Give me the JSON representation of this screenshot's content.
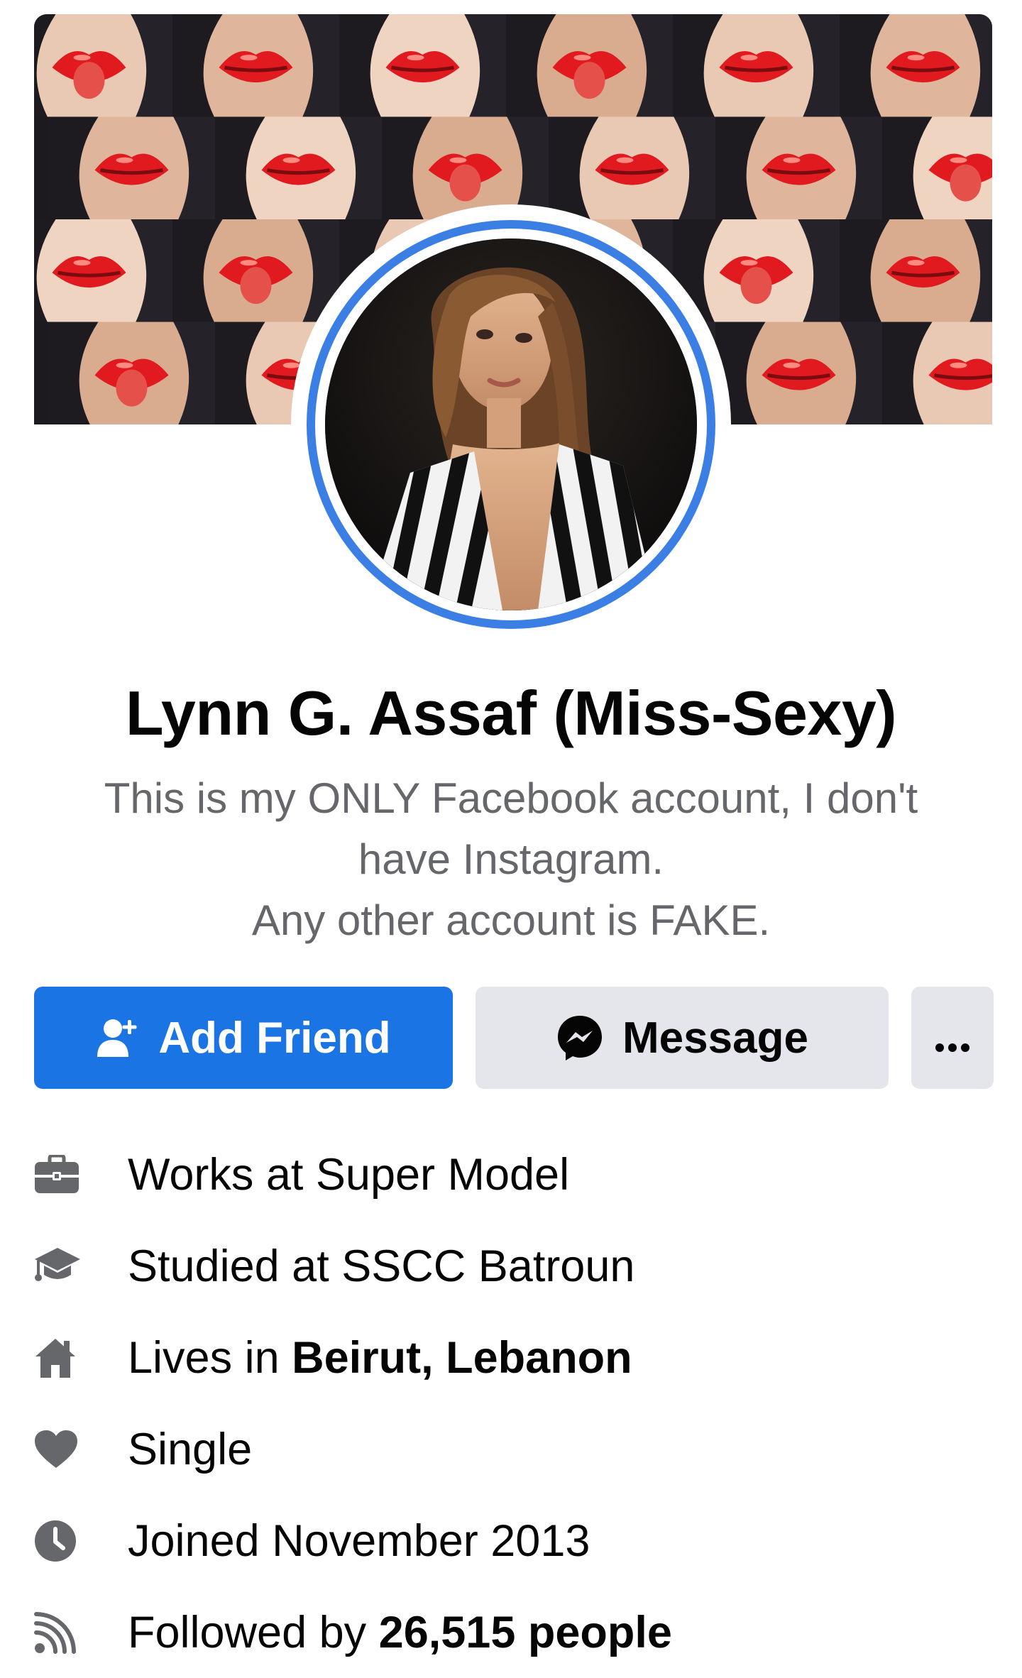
{
  "profile": {
    "name": "Lynn G. Assaf (Miss-Sexy)",
    "bio_lines": [
      "This is my ONLY Facebook account, I don't",
      "have Instagram.",
      "Any other account is FAKE."
    ]
  },
  "actions": {
    "add_friend_label": "Add Friend",
    "message_label": "Message",
    "more_icon": "more-dots-icon"
  },
  "details": [
    {
      "icon": "briefcase-icon",
      "prefix": "Works at Super Model",
      "bold": ""
    },
    {
      "icon": "graduation-cap-icon",
      "prefix": "Studied at SSCC Batroun",
      "bold": ""
    },
    {
      "icon": "home-icon",
      "prefix": "Lives in ",
      "bold": "Beirut, Lebanon"
    },
    {
      "icon": "heart-icon",
      "prefix": "Single",
      "bold": ""
    },
    {
      "icon": "clock-icon",
      "prefix": "Joined November 2013",
      "bold": ""
    },
    {
      "icon": "rss-icon",
      "prefix": "Followed by ",
      "bold": "26,515 people"
    }
  ],
  "colors": {
    "accent": "#1b74e4",
    "avatar_ring": "#3b7ee4",
    "secondary_text": "#65676b",
    "button_gray": "#e4e6eb",
    "icon_gray": "#65676b"
  }
}
